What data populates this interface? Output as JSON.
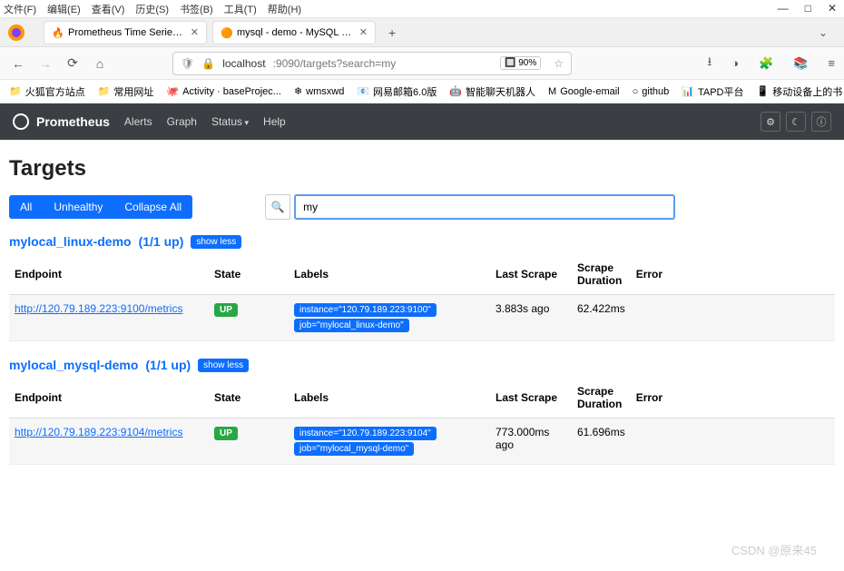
{
  "menubar": [
    "文件(F)",
    "编辑(E)",
    "查看(V)",
    "历史(S)",
    "书签(B)",
    "工具(T)",
    "帮助(H)"
  ],
  "winctrls": {
    "min": "—",
    "max": "□",
    "close": "✕"
  },
  "tabs": [
    {
      "title": "Prometheus Time Series Coll",
      "icon": "🔥"
    },
    {
      "title": "mysql - demo - MySQL - Das",
      "icon": "🟠"
    }
  ],
  "url": {
    "host": "localhost",
    "rest": ":9090/targets?search=my",
    "zoom": "90%"
  },
  "bookmarks": [
    {
      "icon": "📁",
      "label": "火狐官方站点"
    },
    {
      "icon": "📁",
      "label": "常用网址"
    },
    {
      "icon": "🐙",
      "label": "Activity · baseProjec..."
    },
    {
      "icon": "❄",
      "label": "wmsxwd"
    },
    {
      "icon": "📧",
      "label": "网易邮箱6.0版"
    },
    {
      "icon": "🤖",
      "label": "智能聊天机器人"
    },
    {
      "icon": "M",
      "label": "Google-email"
    },
    {
      "icon": "○",
      "label": "github"
    },
    {
      "icon": "📊",
      "label": "TAPD平台"
    }
  ],
  "bookmark_right": "移动设备上的书",
  "promnav": {
    "brand": "Prometheus",
    "links": [
      "Alerts",
      "Graph",
      "Status",
      "Help"
    ]
  },
  "page_title": "Targets",
  "filter_buttons": [
    "All",
    "Unhealthy",
    "Collapse All"
  ],
  "search_value": "my",
  "table_headers": {
    "endpoint": "Endpoint",
    "state": "State",
    "labels": "Labels",
    "last_scrape": "Last Scrape",
    "scrape_duration": "Scrape Duration",
    "error": "Error"
  },
  "showless": "show less",
  "jobs": [
    {
      "name": "mylocal_linux-demo",
      "count": "(1/1 up)",
      "rows": [
        {
          "endpoint": "http://120.79.189.223:9100/metrics",
          "state": "UP",
          "labels": [
            "instance=\"120.79.189.223:9100\"",
            "job=\"mylocal_linux-demo\""
          ],
          "last_scrape": "3.883s ago",
          "duration": "62.422ms",
          "error": ""
        }
      ]
    },
    {
      "name": "mylocal_mysql-demo",
      "count": "(1/1 up)",
      "rows": [
        {
          "endpoint": "http://120.79.189.223:9104/metrics",
          "state": "UP",
          "labels": [
            "instance=\"120.79.189.223:9104\"",
            "job=\"mylocal_mysql-demo\""
          ],
          "last_scrape": "773.000ms ago",
          "duration": "61.696ms",
          "error": ""
        }
      ]
    }
  ],
  "watermark": "CSDN @原来45"
}
